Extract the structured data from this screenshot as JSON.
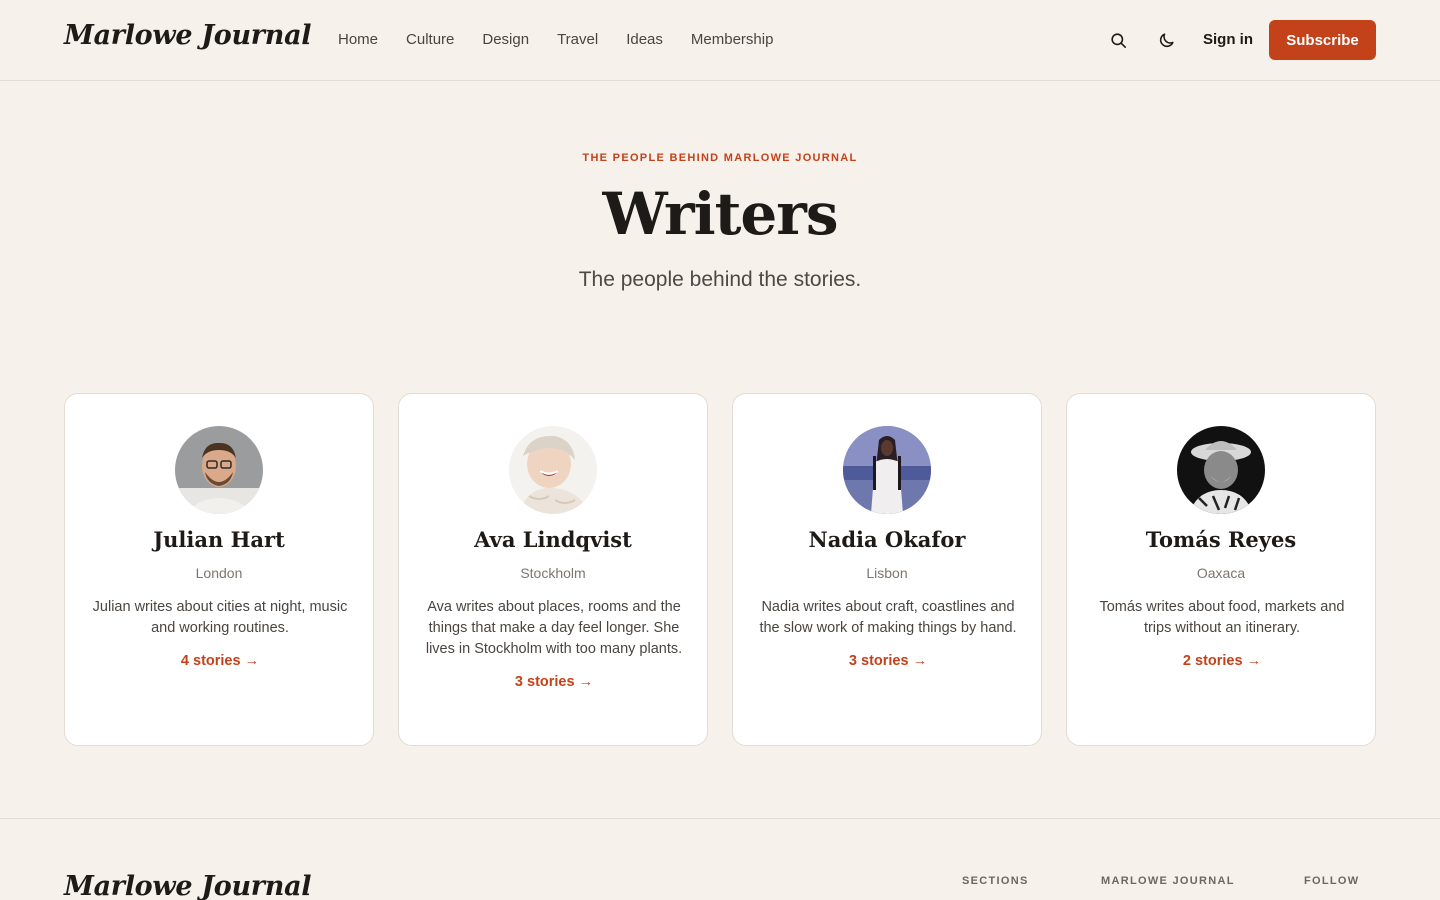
{
  "header": {
    "logo": "Marlowe Journal",
    "nav": [
      "Home",
      "Culture",
      "Design",
      "Travel",
      "Ideas",
      "Membership"
    ],
    "icons": [
      "search-icon",
      "moon-icon"
    ],
    "signin_label": "Sign in",
    "subscribe_label": "Subscribe"
  },
  "hero": {
    "eyebrow": "THE PEOPLE BEHIND MARLOWE JOURNAL",
    "title": "Writers",
    "subtitle": "The people behind the stories."
  },
  "writers": [
    {
      "name": "Julian Hart",
      "city": "London",
      "bio": "Julian writes about cities at night, music and working routines.",
      "stories": "4 stories →"
    },
    {
      "name": "Ava Lindqvist",
      "city": "Stockholm",
      "bio": "Ava writes about places, rooms and the things that make a day feel longer. She lives in Stockholm with too many plants.",
      "stories": "3 stories →"
    },
    {
      "name": "Nadia Okafor",
      "city": "Lisbon",
      "bio": "Nadia writes about craft, coastlines and the slow work of making things by hand.",
      "stories": "3 stories →"
    },
    {
      "name": "Tomás Reyes",
      "city": "Oaxaca",
      "bio": "Tomás writes about food, markets and trips without an itinerary.",
      "stories": "2 stories →"
    }
  ],
  "footer": {
    "logo": "Marlowe Journal",
    "columns": [
      "SECTIONS",
      "MARLOWE JOURNAL",
      "FOLLOW"
    ]
  },
  "colors": {
    "background": "#f6f1eb",
    "accent": "#c4421a",
    "card": "#ffffff",
    "text": "#1d1a17"
  }
}
